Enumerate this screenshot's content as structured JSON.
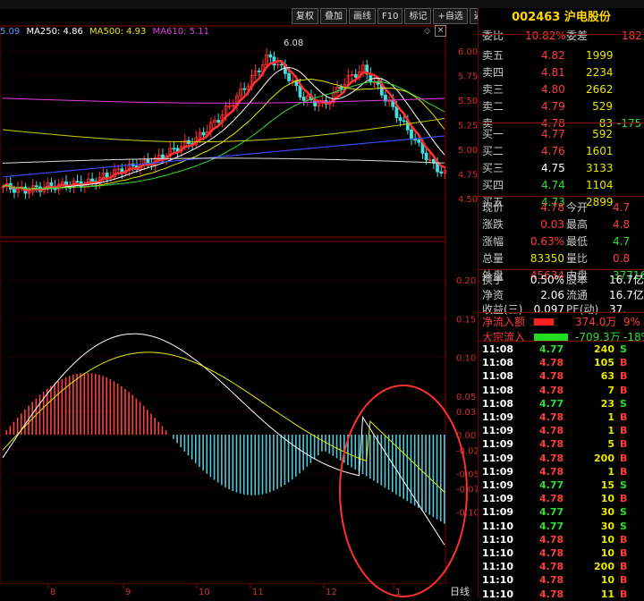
{
  "toolbar": {
    "buttons": [
      "复权",
      "叠加",
      "画线",
      "F10",
      "标记",
      "+自选",
      "返回"
    ]
  },
  "legend": {
    "items": [
      {
        "label": "5.09",
        "color": "#4aa0ff"
      },
      {
        "label": "MA250: 4.86",
        "color": "#ffffff"
      },
      {
        "label": "MA500: 4.93",
        "color": "#e8e800"
      },
      {
        "label": "MA610: 5.11",
        "color": "#e040e0"
      }
    ]
  },
  "price_axis": {
    "labels": [
      "6.00",
      "5.75",
      "5.50",
      "5.25",
      "5.00",
      "4.75",
      "4.50"
    ],
    "peak_label": "6.08"
  },
  "macd_axis": {
    "labels": [
      "0.20",
      "0.15",
      "0.10",
      "0.05",
      "0.03",
      "0.00",
      "-0.02",
      "-0.05",
      "-0.07",
      "-0.10"
    ]
  },
  "date_axis": {
    "labels": [
      "8",
      "9",
      "10",
      "11",
      "12",
      "1"
    ],
    "period_label": "日线"
  },
  "stock": {
    "code": "002463",
    "name": "沪电股份"
  },
  "order_ratio": {
    "label1": "委比",
    "value1": "10.82%",
    "label2": "委差",
    "value2": "182"
  },
  "asks": [
    {
      "label": "卖五",
      "price": "4.82",
      "vol": "1999"
    },
    {
      "label": "卖四",
      "price": "4.81",
      "vol": "2234"
    },
    {
      "label": "卖三",
      "price": "4.80",
      "vol": "2662"
    },
    {
      "label": "卖二",
      "price": "4.79",
      "vol": "529"
    },
    {
      "label": "卖一",
      "price": "4.78",
      "vol": "83",
      "extra": "-175"
    }
  ],
  "bids": [
    {
      "label": "买一",
      "price": "4.77",
      "vol": "592"
    },
    {
      "label": "买二",
      "price": "4.76",
      "vol": "1601"
    },
    {
      "label": "买三",
      "price": "4.75",
      "vol": "3133"
    },
    {
      "label": "买四",
      "price": "4.74",
      "vol": "1104"
    },
    {
      "label": "买五",
      "price": "4.73",
      "vol": "2899"
    }
  ],
  "stats": [
    {
      "l1": "现价",
      "v1": "4.78",
      "l2": "今开",
      "v2": "4.7"
    },
    {
      "l1": "涨跌",
      "v1": "0.03",
      "l2": "最高",
      "v2": "4.8"
    },
    {
      "l1": "涨幅",
      "v1": "0.63%",
      "l2": "最低",
      "v2": "4.7"
    },
    {
      "l1": "总量",
      "v1": "83350",
      "l2": "量比",
      "v2": "0.8"
    },
    {
      "l1": "外盘",
      "v1": "45634",
      "l2": "内盘",
      "v2": "37716"
    }
  ],
  "fin": [
    {
      "l1": "换手",
      "v1": "0.50%",
      "l2": "股本",
      "v2": "16.7亿"
    },
    {
      "l1": "净资",
      "v1": "2.06",
      "l2": "流通",
      "v2": "16.7亿"
    },
    {
      "l1": "收益(三)",
      "v1": "0.097",
      "l2": "PE(动)",
      "v2": "37."
    }
  ],
  "flow": [
    {
      "label": "净流入额",
      "value": "374.0万",
      "pct": "9%",
      "bar": "red"
    },
    {
      "label": "大宗流入",
      "value": "-709.3万",
      "pct": "-18%",
      "bar": "green"
    }
  ],
  "trades": [
    {
      "t": "11:08",
      "p": "4.77",
      "v": "240",
      "s": "S"
    },
    {
      "t": "11:08",
      "p": "4.78",
      "v": "105",
      "s": "B"
    },
    {
      "t": "11:08",
      "p": "4.78",
      "v": "63",
      "s": "B"
    },
    {
      "t": "11:08",
      "p": "4.78",
      "v": "7",
      "s": "B"
    },
    {
      "t": "11:08",
      "p": "4.77",
      "v": "23",
      "s": "S"
    },
    {
      "t": "11:09",
      "p": "4.78",
      "v": "1",
      "s": "B"
    },
    {
      "t": "11:09",
      "p": "4.78",
      "v": "1",
      "s": "B"
    },
    {
      "t": "11:09",
      "p": "4.78",
      "v": "5",
      "s": "B"
    },
    {
      "t": "11:09",
      "p": "4.78",
      "v": "200",
      "s": "B"
    },
    {
      "t": "11:09",
      "p": "4.78",
      "v": "1",
      "s": "B"
    },
    {
      "t": "11:09",
      "p": "4.77",
      "v": "15",
      "s": "S"
    },
    {
      "t": "11:09",
      "p": "4.78",
      "v": "10",
      "s": "B"
    },
    {
      "t": "11:09",
      "p": "4.77",
      "v": "30",
      "s": "S"
    },
    {
      "t": "11:10",
      "p": "4.77",
      "v": "30",
      "s": "S"
    },
    {
      "t": "11:10",
      "p": "4.78",
      "v": "10",
      "s": "B"
    },
    {
      "t": "11:10",
      "p": "4.78",
      "v": "10",
      "s": "B"
    },
    {
      "t": "11:10",
      "p": "4.78",
      "v": "200",
      "s": "B"
    },
    {
      "t": "11:10",
      "p": "4.78",
      "v": "10",
      "s": "B"
    },
    {
      "t": "11:10",
      "p": "4.78",
      "v": "11",
      "s": "B"
    }
  ],
  "chart_data": [
    {
      "type": "candlestick",
      "y_axis_ticks": [
        6.0,
        5.75,
        5.5,
        5.25,
        5.0,
        4.75,
        4.5
      ],
      "ylim": [
        4.4,
        6.15
      ],
      "annotated_high": 6.08,
      "last_price": 4.78,
      "legend": [
        "MA250: 4.86",
        "MA500: 4.93",
        "MA610: 5.11"
      ],
      "x_tick_labels": [
        "8",
        "9",
        "10",
        "11",
        "12",
        "1"
      ]
    },
    {
      "type": "bar",
      "indicator": "MACD",
      "y_axis_ticks": [
        0.2,
        0.15,
        0.1,
        0.05,
        0.03,
        0.0,
        -0.02,
        -0.05,
        -0.07,
        -0.1
      ],
      "ylim": [
        -0.16,
        0.23
      ]
    }
  ]
}
